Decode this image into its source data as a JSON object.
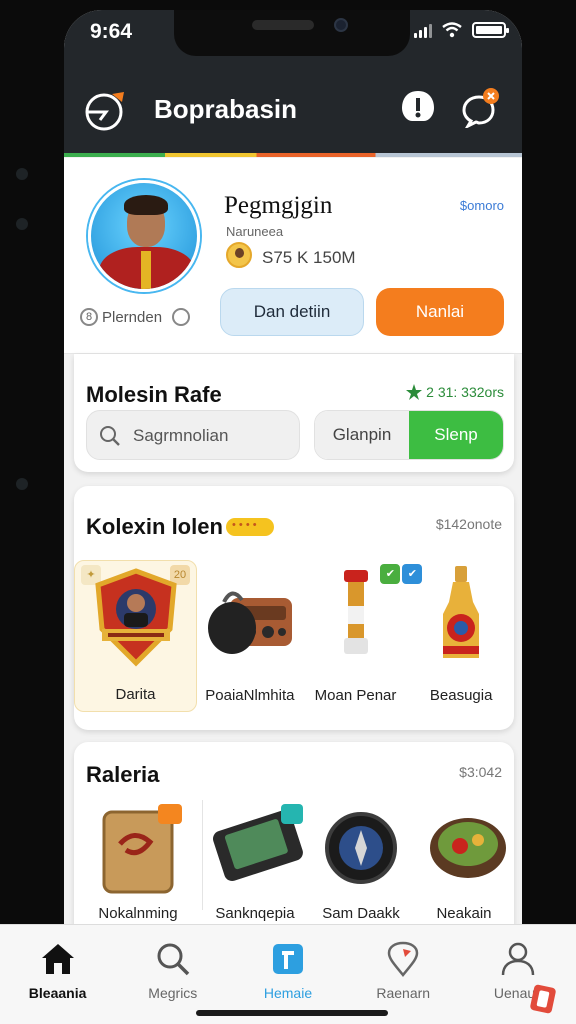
{
  "status_bar": {
    "time": "9:64"
  },
  "header": {
    "title": "Boprabasin",
    "colors": {
      "background": "#23272b",
      "accent_orange": "#f47d1e",
      "notification_red": "#e24b3b"
    },
    "icons": [
      "logo-icon",
      "alert-icon",
      "chat-icon"
    ]
  },
  "profile": {
    "name": "Pegmgjgin",
    "subtitle": "Naruneea",
    "balance": "S75 K 150M",
    "top_link": "$omoro",
    "level_label": "Plernden",
    "secondary_button": "Dan detiin",
    "primary_button": "Nanlai"
  },
  "search": {
    "section_title": "Molesin Rafe",
    "rating": "2 31: 332ors",
    "placeholder": "Sagrmnolian",
    "segment_off": "Glanpin",
    "segment_on": "Slenp",
    "colors": {
      "segment_active": "#3dbd42"
    }
  },
  "collection": {
    "title": "Kolexin lolen",
    "right_text": "$142onote",
    "items": [
      {
        "label": "Darita",
        "icon": "player-badge-icon"
      },
      {
        "label": "PoaiaNlmhita",
        "icon": "radio-speaker-icon"
      },
      {
        "label": "Moan Penar",
        "icon": "candle-bottle-icon"
      },
      {
        "label": "Beasugia",
        "icon": "drink-bottle-icon"
      }
    ]
  },
  "gallery": {
    "title": "Raleria",
    "right_text": "$3:042",
    "items": [
      {
        "label": "Nokalnming",
        "icon": "gold-card-icon"
      },
      {
        "label": "Sanknqepia",
        "icon": "handheld-console-icon"
      },
      {
        "label": "Sam Daakk",
        "icon": "compass-gadget-icon"
      },
      {
        "label": "Neakain",
        "icon": "food-bowl-icon"
      }
    ]
  },
  "bottom_nav": {
    "items": [
      {
        "label": "Bleaania",
        "icon": "home-icon"
      },
      {
        "label": "Megrics",
        "icon": "search-icon"
      },
      {
        "label": "Hemaie",
        "icon": "bookmark-icon"
      },
      {
        "label": "Raenarn",
        "icon": "map-pin-icon"
      },
      {
        "label": "Uenaun",
        "icon": "profile-icon"
      }
    ]
  }
}
